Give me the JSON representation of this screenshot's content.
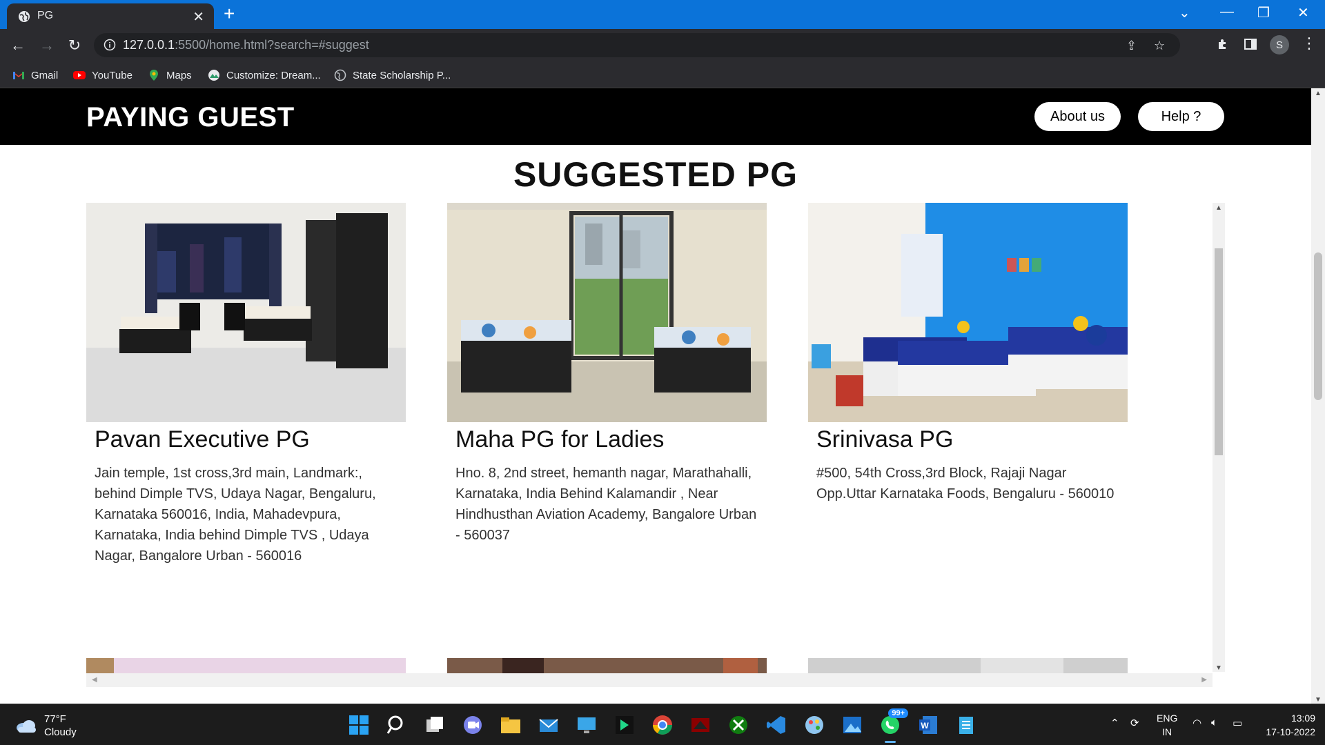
{
  "browser": {
    "tab_title": "PG",
    "url_host": "127.0.0.1",
    "url_rest": ":5500/home.html?search=#suggest",
    "profile_initial": "S",
    "bookmarks": [
      {
        "label": "Gmail",
        "icon": "gmail-icon"
      },
      {
        "label": "YouTube",
        "icon": "youtube-icon"
      },
      {
        "label": "Maps",
        "icon": "maps-icon"
      },
      {
        "label": "Customize: Dream...",
        "icon": "customize-icon"
      },
      {
        "label": "State Scholarship P...",
        "icon": "globe-icon"
      }
    ]
  },
  "header": {
    "brand": "PAYING GUEST",
    "about_label": "About us",
    "help_label": "Help ?"
  },
  "section": {
    "title": "SUGGESTED PG"
  },
  "listings": [
    {
      "name": "Pavan Executive PG",
      "address": "Jain temple, 1st cross,3rd main, Landmark:, behind Dimple TVS, Udaya Nagar, Bengaluru, Karnataka 560016, India, Mahadevpura, Karnataka, India behind Dimple TVS , Udaya Nagar, Bangalore Urban - 560016"
    },
    {
      "name": "Maha PG for Ladies",
      "address": "Hno. 8, 2nd street, hemanth nagar, Marathahalli, Karnataka, India Behind Kalamandir , Near Hindhusthan Aviation Academy, Bangalore Urban - 560037"
    },
    {
      "name": "Srinivasa PG",
      "address": "#500, 54th Cross,3rd Block, Rajaji Nagar Opp.Uttar Karnataka Foods, Bengaluru - 560010"
    }
  ],
  "taskbar": {
    "temperature": "77°F",
    "condition": "Cloudy",
    "whatsapp_badge": "99+",
    "lang_line1": "ENG",
    "lang_line2": "IN",
    "time": "13:09",
    "date": "17-10-2022"
  }
}
